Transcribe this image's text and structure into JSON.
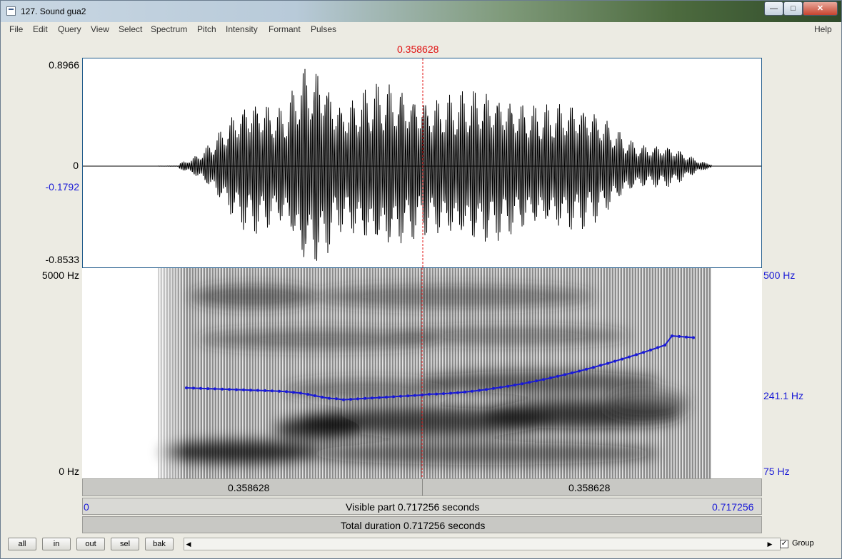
{
  "window": {
    "title": "127. Sound gua2"
  },
  "menu": [
    "File",
    "Edit",
    "Query",
    "View",
    "Select",
    "Spectrum",
    "Pitch",
    "Intensity",
    "Formant",
    "Pulses"
  ],
  "help": "Help",
  "cursor": {
    "time": "0.358628"
  },
  "waveform": {
    "y_max": "0.8966",
    "y_zero": "0",
    "y_cursor": "-0.1792",
    "y_min": "-0.8533"
  },
  "spectrogram": {
    "freq_max": "5000 Hz",
    "freq_min": "0 Hz",
    "pitch_max": "500 Hz",
    "pitch_cursor": "241.1 Hz",
    "pitch_min": "75 Hz"
  },
  "time_bar": {
    "left": "0.358628",
    "right": "0.358628"
  },
  "visible_bar": {
    "start": "0",
    "text": "Visible part 0.717256 seconds",
    "end": "0.717256"
  },
  "total_bar": {
    "text": "Total duration 0.717256 seconds"
  },
  "buttons": {
    "all": "all",
    "in": "in",
    "out": "out",
    "sel": "sel",
    "bak": "bak"
  },
  "group": {
    "label": "Group",
    "checked": true
  },
  "colors": {
    "cursor": "#e01010",
    "pitch": "#1a1ad6",
    "waveform": "#000000"
  }
}
